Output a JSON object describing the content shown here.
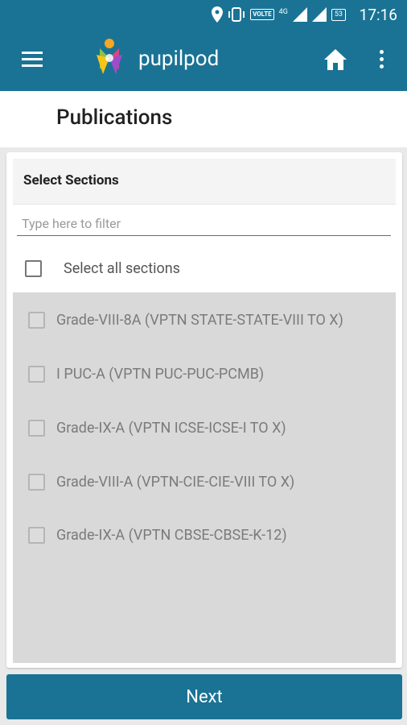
{
  "status_bar": {
    "time": "17:16",
    "volte": "VOLTE",
    "network": "4G",
    "battery": "53"
  },
  "app_bar": {
    "brand": "pupilpod"
  },
  "page": {
    "title": "Publications"
  },
  "card": {
    "header": "Select Sections",
    "filter_placeholder": "Type here to filter",
    "select_all_label": "Select all sections",
    "items": [
      {
        "label": "Grade-VIII-8A (VPTN STATE-STATE-VIII TO X)"
      },
      {
        "label": "I PUC-A (VPTN PUC-PUC-PCMB)"
      },
      {
        "label": "Grade-IX-A (VPTN ICSE-ICSE-I TO X)"
      },
      {
        "label": "Grade-VIII-A (VPTN-CIE-CIE-VIII TO X)"
      },
      {
        "label": "Grade-IX-A (VPTN CBSE-CBSE-K-12)"
      }
    ]
  },
  "footer": {
    "next_label": "Next"
  },
  "colors": {
    "primary": "#1a7394",
    "list_background": "#d9d9d9"
  }
}
